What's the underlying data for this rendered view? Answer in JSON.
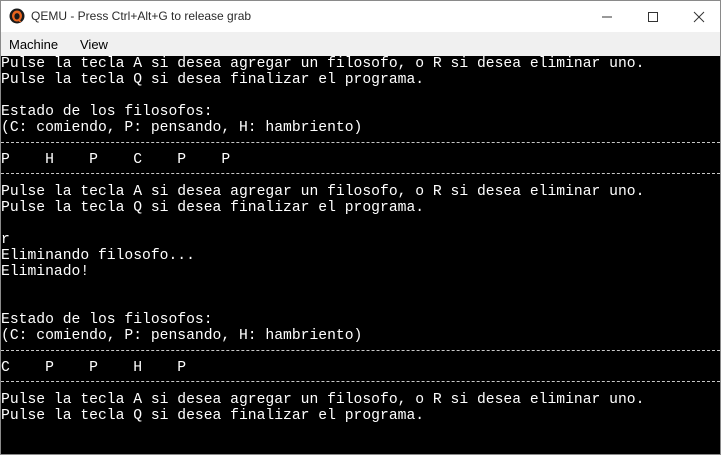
{
  "window": {
    "title": "QEMU - Press Ctrl+Alt+G to release grab"
  },
  "menu": {
    "items": [
      {
        "label": "Machine"
      },
      {
        "label": "View"
      }
    ]
  },
  "console": {
    "lines": [
      "Pulse la tecla A si desea agregar un filosofo, o R si desea eliminar uno.",
      "Pulse la tecla Q si desea finalizar el programa.",
      "",
      "Estado de los filosofos:",
      "(C: comiendo, P: pensando, H: hambriento)",
      "",
      "P    H    P    C    P    P",
      "",
      "Pulse la tecla A si desea agregar un filosofo, o R si desea eliminar uno.",
      "Pulse la tecla Q si desea finalizar el programa.",
      "",
      "r",
      "Eliminando filosofo...",
      "Eliminado!",
      "",
      "",
      "Estado de los filosofos:",
      "(C: comiendo, P: pensando, H: hambriento)",
      "",
      "C    P    P    H    P",
      "",
      "Pulse la tecla A si desea agregar un filosofo, o R si desea eliminar uno.",
      "Pulse la tecla Q si desea finalizar el programa."
    ]
  }
}
